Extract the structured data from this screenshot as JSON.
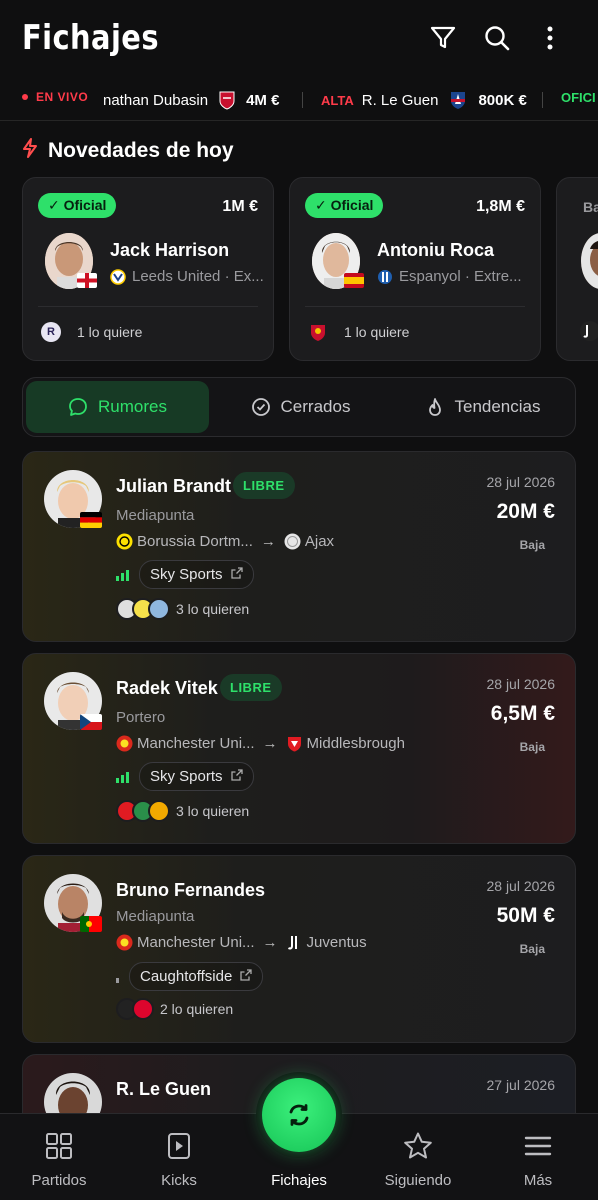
{
  "header": {
    "title": "Fichajes"
  },
  "ticker": {
    "live_label": "EN VIVO",
    "items": [
      {
        "name": "nathan Dubasin",
        "price": "4M €"
      },
      {
        "tag": "ALTA",
        "name": "R. Le Guen",
        "price": "800K €"
      },
      {
        "tag": "OFICI"
      }
    ]
  },
  "novedades": {
    "title": "Novedades de hoy",
    "cards": [
      {
        "badge": "✓ Oficial",
        "price": "1M €",
        "name": "Jack Harrison",
        "club": "Leeds United · Ex...",
        "wants": "1 lo quiere"
      },
      {
        "badge": "✓ Oficial",
        "price": "1,8M €",
        "name": "Antoniu Roca",
        "club": "Espanyol · Extre...",
        "wants": "1 lo quiere"
      },
      {
        "badge": "Ba"
      }
    ]
  },
  "tabs": [
    {
      "label": "Rumores",
      "active": true
    },
    {
      "label": "Cerrados",
      "active": false
    },
    {
      "label": "Tendencias",
      "active": false
    }
  ],
  "rumors": [
    {
      "name": "Julian Brandt",
      "status": "LIBRE",
      "position": "Mediapunta",
      "from": "Borussia Dortm...",
      "to": "Ajax",
      "source": "Sky Sports",
      "wants": "3 lo quieren",
      "date": "28 jul 2026",
      "price": "20M €",
      "trend": "Baja"
    },
    {
      "name": "Radek Vitek",
      "status": "LIBRE",
      "position": "Portero",
      "from": "Manchester Uni...",
      "to": "Middlesbrough",
      "source": "Sky Sports",
      "wants": "3 lo quieren",
      "date": "28 jul 2026",
      "price": "6,5M €",
      "trend": "Baja"
    },
    {
      "name": "Bruno Fernandes",
      "position": "Mediapunta",
      "from": "Manchester Uni...",
      "to": "Juventus",
      "source": "Caughtoffside",
      "wants": "2 lo quieren",
      "date": "28 jul 2026",
      "price": "50M €",
      "trend": "Baja"
    },
    {
      "name": "R. Le Guen",
      "date": "27 jul 2026"
    }
  ],
  "bottom_nav": [
    {
      "label": "Partidos",
      "icon": "grid-icon"
    },
    {
      "label": "Kicks",
      "icon": "play-icon"
    },
    {
      "label": "Fichajes",
      "icon": "swap-icon",
      "active": true
    },
    {
      "label": "Siguiendo",
      "icon": "star-icon"
    },
    {
      "label": "Más",
      "icon": "menu-icon"
    }
  ],
  "colors": {
    "accent": "#2ee06a",
    "live": "#ff3b4a",
    "background": "#0f0f10",
    "card": "#1c1c1e"
  }
}
